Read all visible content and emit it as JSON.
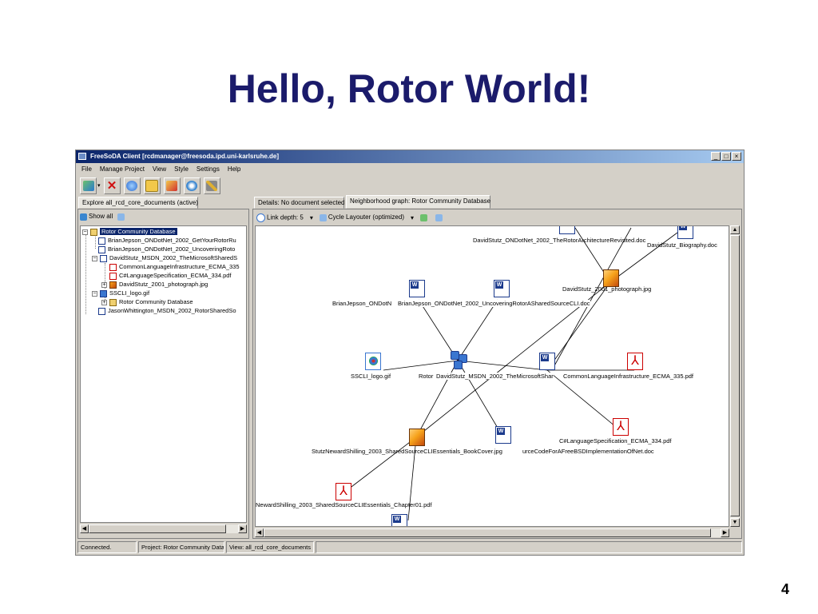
{
  "slide": {
    "title": "Hello, Rotor World!",
    "page_number": "4"
  },
  "window": {
    "title": "FreeSoDA Client [rcdmanager@freesoda.ipd.uni-karlsruhe.de]"
  },
  "menu": [
    "File",
    "Manage Project",
    "View",
    "Style",
    "Settings",
    "Help"
  ],
  "toolbar": {
    "icons": [
      "connect-icon",
      "delete-icon",
      "globe-icon",
      "folder-icon",
      "import-icon",
      "refresh-icon",
      "tools-icon"
    ]
  },
  "left_tab": "Explore all_rcd_core_documents (active)",
  "left_toolbar": {
    "show_all": "Show all"
  },
  "tree": [
    "Rotor Community Database",
    "BrianJepson_ONDotNet_2002_GetYourRotorRu",
    "BrianJepson_ONDotNet_2002_UncoveringRoto",
    "DavidStutz_MSDN_2002_TheMicrosoftSharedS",
    "CommonLanguageInfrastructure_ECMA_335",
    "C#LanguageSpecification_ECMA_334.pdf",
    "DavidStutz_2001_photograph.jpg",
    "SSCLI_logo.gif",
    "Rotor Community Database",
    "JasonWhittington_MSDN_2002_RotorSharedSo"
  ],
  "right_tabs": [
    "Details: No document selected",
    "Neighborhood graph: Rotor Community Database"
  ],
  "right_toolbar": {
    "link_depth": "Link depth: 5",
    "layouter": "Cycle Layouter (optimized)"
  },
  "graph": {
    "labels": [
      "DavidStutz_ONDotNet_2002_TheRotorArchitectureRevisited.doc",
      "DavidStutz_Biography.doc",
      "DavidStutz_2001_photograph.jpg",
      "BrianJepson_ONDotN",
      "BrianJepson_ONDotNet_2002_UncoveringRotorASharedSourceCLI.doc",
      "SSCLI_logo.gif",
      "Rotor",
      "DavidStutz_MSDN_2002_TheMicrosoftShar",
      "CommonLanguageInfrastructure_ECMA_335.pdf",
      "StutzNewardShilling_2003_SharedSourceCLIEssentials_BookCover.jpg",
      "urceCodeForAFreeBSDImplementationOfNet.doc",
      "C#LanguageSpecification_ECMA_334.pdf",
      "NewardShilling_2003_SharedSourceCLIEssentials_Chapter01.pdf"
    ]
  },
  "status": [
    "Connected.",
    "Project: Rotor Community Data",
    "View: all_rcd_core_documents"
  ]
}
